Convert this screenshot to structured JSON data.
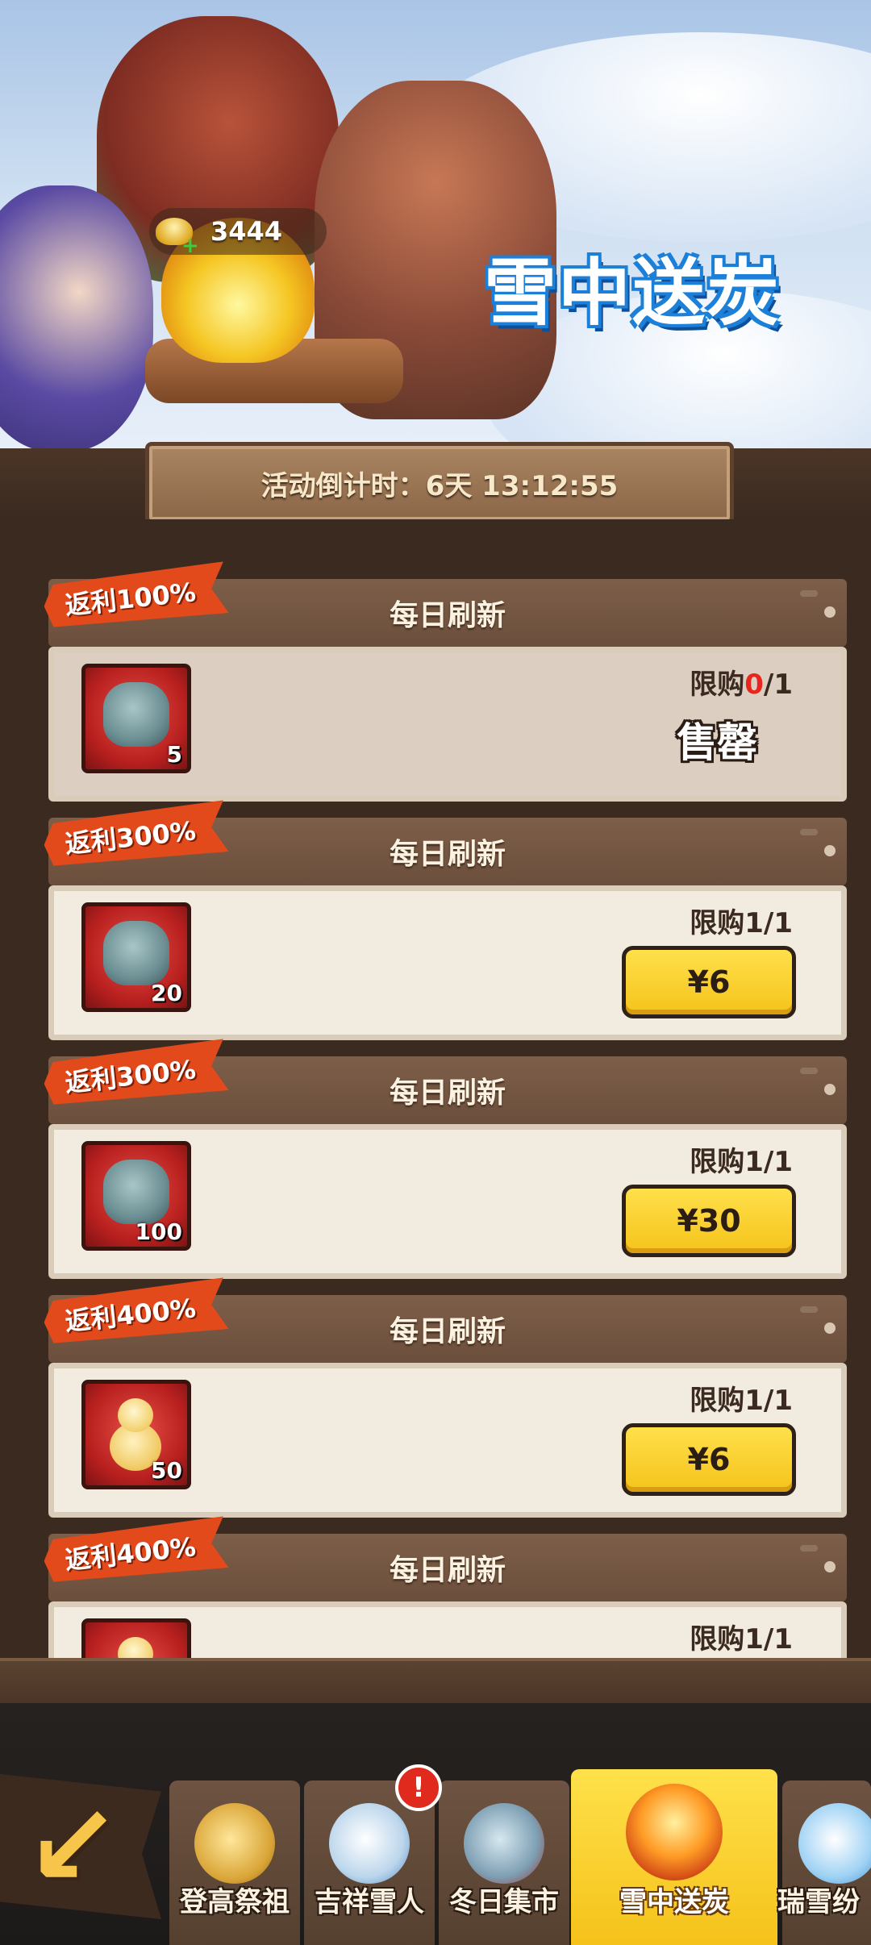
{
  "banner": {
    "event_title": "雪中送炭",
    "currency_amount": "3444"
  },
  "countdown": {
    "text": "活动倒计时：6天 13:12:55"
  },
  "deals": [
    {
      "ribbon": "返利100%",
      "header": "每日刷新",
      "quantity": "5",
      "limit_label": "限购",
      "limit_used": "0",
      "limit_total": "/1",
      "sold_out": "售罄",
      "price": "",
      "item": "mask"
    },
    {
      "ribbon": "返利300%",
      "header": "每日刷新",
      "quantity": "20",
      "limit": "限购1/1",
      "price": "¥6",
      "item": "mask"
    },
    {
      "ribbon": "返利300%",
      "header": "每日刷新",
      "quantity": "100",
      "limit": "限购1/1",
      "price": "¥30",
      "item": "mask"
    },
    {
      "ribbon": "返利400%",
      "header": "每日刷新",
      "quantity": "50",
      "limit": "限购1/1",
      "price": "¥6",
      "item": "snowman"
    },
    {
      "ribbon": "返利400%",
      "header": "每日刷新",
      "quantity": "",
      "limit": "限购1/1",
      "price": "",
      "item": "snowman"
    }
  ],
  "tabs": [
    {
      "label": "登高祭祖",
      "icon": "ancestor-icon"
    },
    {
      "label": "吉祥雪人",
      "icon": "snowman-icon"
    },
    {
      "label": "冬日集市",
      "icon": "market-icon"
    },
    {
      "label": "雪中送炭",
      "icon": "coal-fire-icon",
      "active": true
    },
    {
      "label": "瑞雪纷",
      "icon": "snowflake-icon"
    }
  ],
  "notification_badge": "!",
  "colors": {
    "buy_button": "#f5c31a",
    "ribbon": "#e24a1c",
    "limit_used_red": "#e8261d",
    "event_title_outline": "#1c7fd8"
  }
}
